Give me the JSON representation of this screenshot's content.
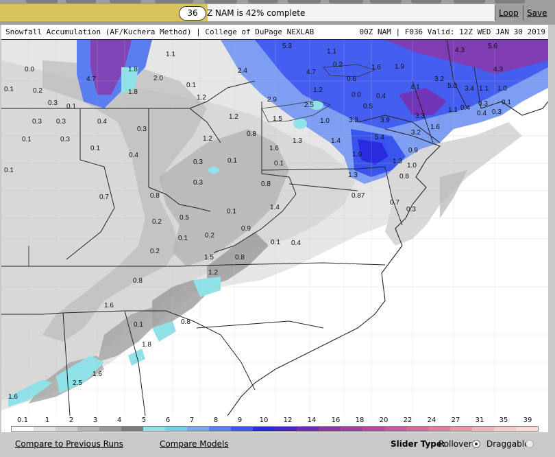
{
  "toolbar": {
    "frame_number": "36",
    "progress_text": "Z NAM is 42% complete",
    "progress_fraction": 0.42,
    "loop_label": "Loop",
    "save_label": "Save"
  },
  "map": {
    "header_left": "Snowfall Accumulation (AF/Kuchera Method) | College of DuPage NEXLAB",
    "header_right": "00Z NAM | F036 Valid: 12Z WED JAN 30 2019",
    "labels": [
      {
        "t": "1.1"
      },
      {
        "t": "5.3"
      },
      {
        "t": "1.1"
      },
      {
        "t": "5.6"
      },
      {
        "t": "4.3"
      },
      {
        "t": "0.0"
      },
      {
        "t": "4.7"
      },
      {
        "t": "1.8"
      },
      {
        "t": "2.0"
      },
      {
        "t": "2.4"
      },
      {
        "t": "4.7"
      },
      {
        "t": "0.2"
      },
      {
        "t": "1.6"
      },
      {
        "t": "1.9"
      },
      {
        "t": "4.3"
      },
      {
        "t": "0.1"
      },
      {
        "t": "0.2"
      },
      {
        "t": "1.8"
      },
      {
        "t": "0.1"
      },
      {
        "t": "1.2"
      },
      {
        "t": "0.6"
      },
      {
        "t": "4.1"
      },
      {
        "t": "3.2"
      },
      {
        "t": "5.0"
      },
      {
        "t": "3.4"
      },
      {
        "t": "1.1"
      },
      {
        "t": "1.0"
      },
      {
        "t": "0.3"
      },
      {
        "t": "0.1"
      },
      {
        "t": "1.2"
      },
      {
        "t": "2.9"
      },
      {
        "t": "2.5"
      },
      {
        "t": "0.0"
      },
      {
        "t": "0.4"
      },
      {
        "t": "0.5"
      },
      {
        "t": "1.1"
      },
      {
        "t": "0.4"
      },
      {
        "t": "0.3"
      },
      {
        "t": "0.1"
      },
      {
        "t": "0.4"
      },
      {
        "t": "0.3"
      },
      {
        "t": "0.3"
      },
      {
        "t": "0.3"
      },
      {
        "t": "0.4"
      },
      {
        "t": "1.2"
      },
      {
        "t": "1.5"
      },
      {
        "t": "1.0"
      },
      {
        "t": "3.3"
      },
      {
        "t": "3.9"
      },
      {
        "t": "3.3"
      },
      {
        "t": "0.3"
      },
      {
        "t": "0.8"
      },
      {
        "t": "1.6"
      },
      {
        "t": "0.1"
      },
      {
        "t": "0.3"
      },
      {
        "t": "1.2"
      },
      {
        "t": "1.3"
      },
      {
        "t": "1.4"
      },
      {
        "t": "5.4"
      },
      {
        "t": "3.2"
      },
      {
        "t": "0.1"
      },
      {
        "t": "1.6"
      },
      {
        "t": "0.9"
      },
      {
        "t": "0.4"
      },
      {
        "t": "0.1"
      },
      {
        "t": "0.3"
      },
      {
        "t": "0.1"
      },
      {
        "t": "1.9"
      },
      {
        "t": "1.3"
      },
      {
        "t": "0.1"
      },
      {
        "t": "1.0"
      },
      {
        "t": "0.3"
      },
      {
        "t": "0.8"
      },
      {
        "t": "1.3"
      },
      {
        "t": "0.8"
      },
      {
        "t": "0.7"
      },
      {
        "t": "0.8"
      },
      {
        "t": "1.4"
      },
      {
        "t": "0.87"
      },
      {
        "t": "0.7"
      },
      {
        "t": "0.3"
      },
      {
        "t": "0.2"
      },
      {
        "t": "0.5"
      },
      {
        "t": "0.1"
      },
      {
        "t": "0.9"
      },
      {
        "t": "0.1"
      },
      {
        "t": "0.2"
      },
      {
        "t": "0.1"
      },
      {
        "t": "0.4"
      },
      {
        "t": "0.2"
      },
      {
        "t": "1.5"
      },
      {
        "t": "0.8"
      },
      {
        "t": "1.2"
      },
      {
        "t": "0.8"
      },
      {
        "t": "1.6"
      },
      {
        "t": "0.1"
      },
      {
        "t": "0.8"
      },
      {
        "t": "1.8"
      },
      {
        "t": "1.6"
      },
      {
        "t": "2.5"
      },
      {
        "t": "1.6"
      }
    ]
  },
  "legend": {
    "labels": [
      "0.1",
      "1",
      "2",
      "3",
      "4",
      "5",
      "6",
      "7",
      "8",
      "9",
      "10",
      "12",
      "14",
      "16",
      "18",
      "20",
      "22",
      "24",
      "27",
      "31",
      "35",
      "39"
    ],
    "colors": [
      "#ffffff",
      "#e3e3e3",
      "#cfcfcf",
      "#b4b4b4",
      "#999999",
      "#7a7a7a",
      "#8fe3e8",
      "#6fd0e6",
      "#7aa3f0",
      "#5a7ef0",
      "#3a54ee",
      "#2a2be0",
      "#4a24c0",
      "#6a2bb0",
      "#8a36a8",
      "#a23ea0",
      "#b6479e",
      "#c8569c",
      "#d8689c",
      "#e27c9e",
      "#e896a8",
      "#f0b2b8",
      "#f5cbc8",
      "#f8ddd4"
    ]
  },
  "bottom": {
    "compare_runs": "Compare to Previous Runs",
    "compare_models": "Compare Models",
    "slider_type_label": "Slider Type:",
    "rollover_label": "Rollover",
    "draggable_label": "Draggable"
  }
}
